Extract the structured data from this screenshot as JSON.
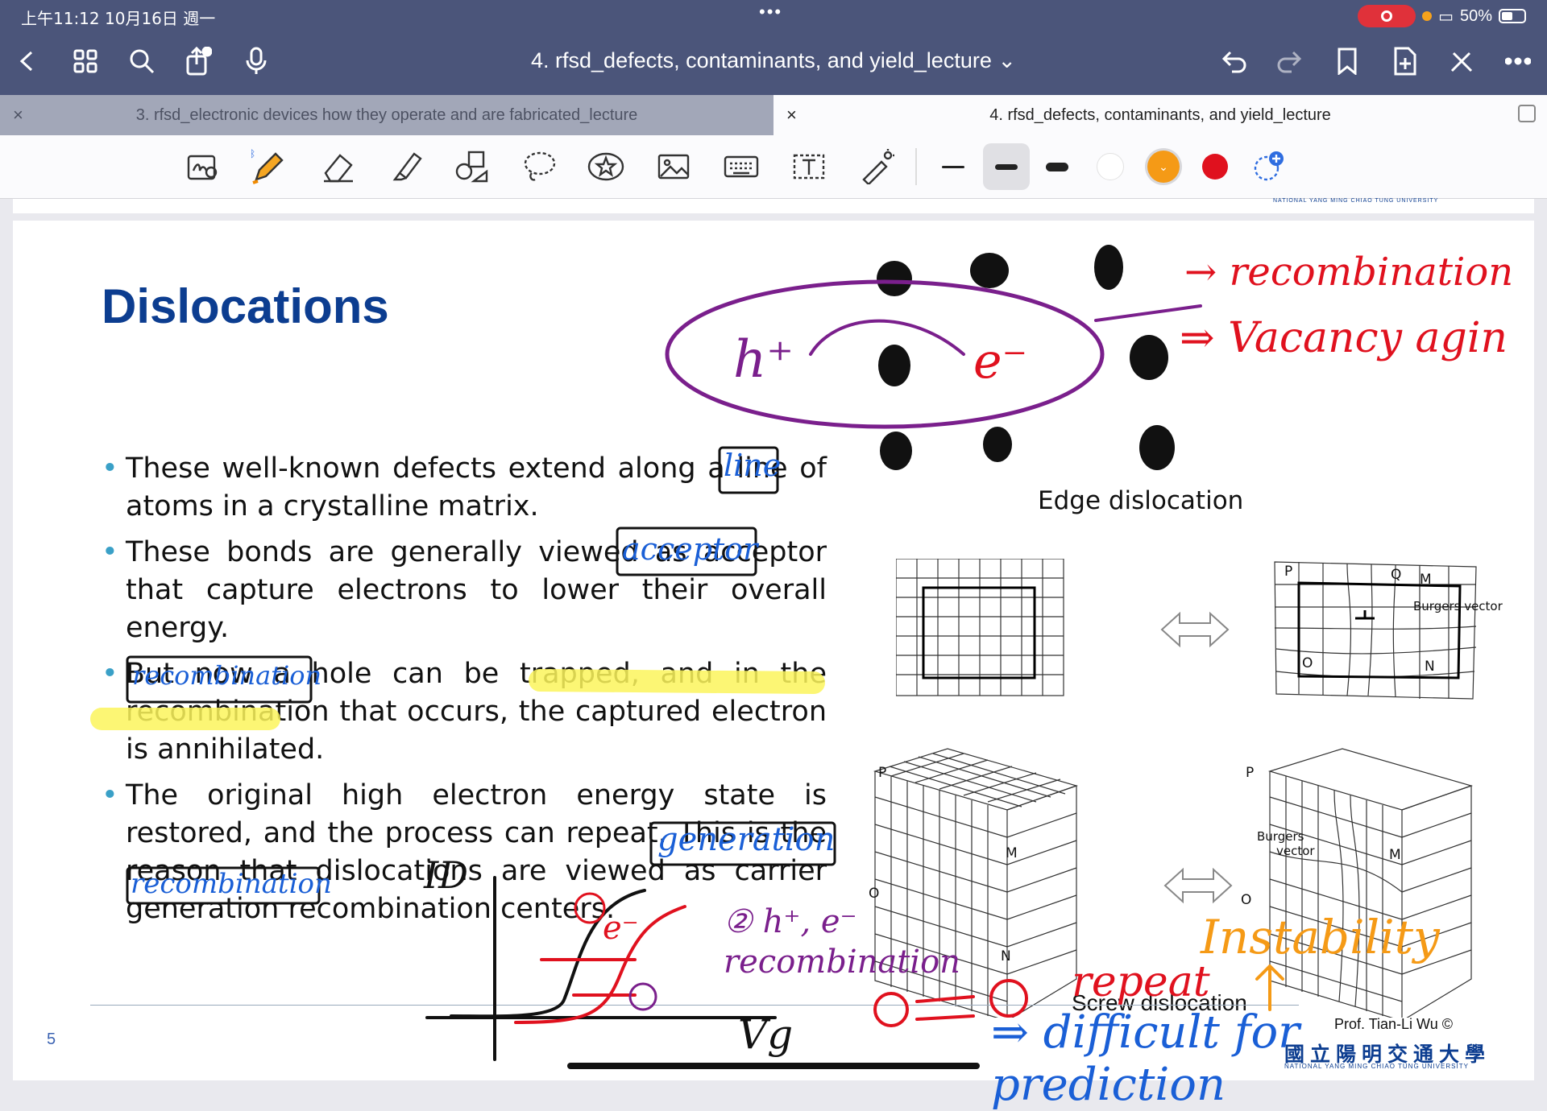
{
  "status": {
    "time": "上午11:12  10月16日 週一",
    "dots": "•••",
    "battery": "50%"
  },
  "nav": {
    "title": "4. rfsd_defects, contaminants, and yield_lecture ⌄"
  },
  "tabs": [
    {
      "label": "3. rfsd_electronic devices how they operate and are fabricated_lecture",
      "close": "×"
    },
    {
      "label": "4. rfsd_defects, contaminants, and yield_lecture",
      "close": "×"
    }
  ],
  "colors": {
    "accent_title": "#0c3d90",
    "nav_bg": "#4b557a",
    "ink_purple": "#7a1f8c",
    "ink_red": "#e0111e",
    "ink_blue": "#1a5fd6",
    "ink_orange": "#f59a16",
    "highlight": "#fbf55c"
  },
  "slide": {
    "title": "Dislocations",
    "bullets": [
      "These well-known defects extend along a line of atoms in a crystalline matrix.",
      "These bonds are generally viewed as acceptor that capture electrons to lower their overall energy.",
      "But now a hole can be trapped, and in the recombination that occurs, the captured electron is annihilated.",
      "The original high electron energy state is restored, and the process can repeat. This is the reason that dislocations are viewed as carrier generation recombination centers."
    ],
    "figure_caption_edge": "Edge dislocation",
    "figure_caption_screw": "Screw dislocation",
    "figure_labels": {
      "p": "P",
      "q": "Q",
      "m": "M",
      "n": "N",
      "o": "O",
      "burgers": "Burgers vector",
      "burgers_a": "Burgers",
      "burgers_b": "vector"
    },
    "page_number": "5",
    "author": "Prof. Tian-Li Wu ©",
    "university_zh": "國立陽明交通大學",
    "university_en": "NATIONAL YANG MING CHIAO TUNG UNIVERSITY"
  },
  "annotations": {
    "h_plus": "h⁺",
    "e_minus": "e⁻",
    "recombination": "→ recombination",
    "vacancy": "⇒ Vacancy agin",
    "box_line": "line",
    "box_acceptor": "acceptor",
    "box_recomb": "recombination",
    "box_generation": "generation",
    "box_recomb2": "recombination",
    "id": "ID",
    "vg": "Vg",
    "circ1": "①",
    "circ2": "②",
    "e_label": "e⁻",
    "step2": "② h⁺, e⁻ recombination",
    "cycle": "① ⇄ ②",
    "repeat": "repeat",
    "difficult": "⇒ difficult for prediction",
    "instability": "Instability"
  }
}
